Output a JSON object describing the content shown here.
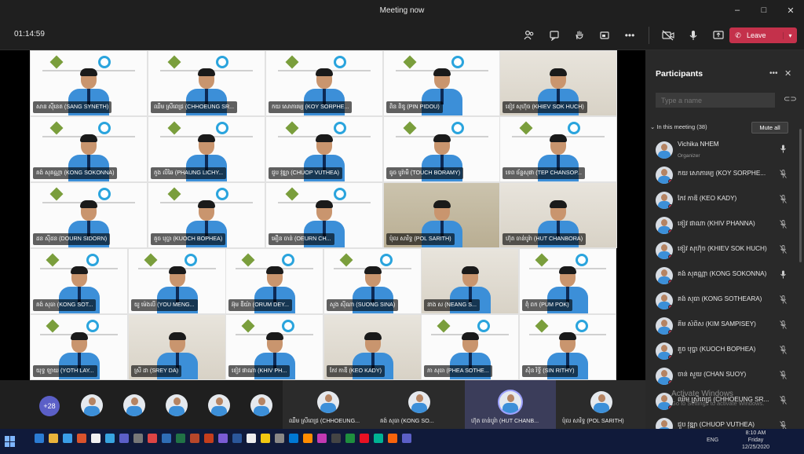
{
  "window": {
    "title": "Meeting now",
    "controls": [
      "–",
      "□",
      "✕"
    ]
  },
  "toolbar": {
    "timer": "01:14:59",
    "icons": [
      "participants-icon",
      "chat-icon",
      "raise-hand-icon",
      "rooms-icon",
      "more-icon",
      "camera-off-icon",
      "mic-icon",
      "share-icon"
    ],
    "leave_label": "Leave"
  },
  "colors": {
    "leave": "#c4314b",
    "panel": "#292929",
    "accent": "#5b5fc7"
  },
  "grid": {
    "tiles": [
      {
        "name": "សាន ស៊ីនេត (SANG SYNETH)"
      },
      {
        "name": "ឈឹម ស្រីពេជ្រ (CHHOEUNG SR..."
      },
      {
        "name": "កយ សោភារម្យ (KOY SORPHE..."
      },
      {
        "name": "ពិន ពិឌូ (PIN PIDOU)"
      },
      {
        "name": "ខៀវ សុហ៊ុច (KHIEV SOK HUCH)"
      },
      {
        "name": "គង់ សុគណ្ណា (KONG SOKONNA)"
      },
      {
        "name": "ភួង លីឆៃ (PHAUNG LICHY..."
      },
      {
        "name": "ជួប វុឌ្ឍា (CHUOP VUTHEA)"
      },
      {
        "name": "ធូច បូរ៉ាមី (TOUCH BORAMY)"
      },
      {
        "name": "ទេព ច័ន្ទសុផា (TEP CHANSOP..."
      },
      {
        "name": "ដន ស៊ីដន (DOURN SIDORN)"
      },
      {
        "name": "គួច បុប្ផា (KUOCH BOPHEA)"
      },
      {
        "name": "អឿន ចាន់ (OEURN CH..."
      },
      {
        "name": "ប៉ុល សារិទ្ធ (POL SARITH)"
      },
      {
        "name": "ហ៊ុត ចាន់បូរ៉ា (HUT CHANBORA)"
      },
      {
        "name": "គង់ សុធា (KONG SOT..."
      },
      {
        "name": "យូ ម៉េងលី (YOU MENG..."
      },
      {
        "name": "អ៊ុម ឌីយ៉ា (ORUM DEY..."
      },
      {
        "name": "សួង ស៊ីណា (SUONG SINA)"
      },
      {
        "name": "នាង ស (NEANG S..."
      },
      {
        "name": "ពុំ ពក (PUM POK)"
      },
      {
        "name": "យុទ្ធ ឡាយ (YOTH LAY..."
      },
      {
        "name": "ស្រី ដា (SREY DA)"
      },
      {
        "name": "ខៀវ ផាណា (KHIV PH..."
      },
      {
        "name": "កែវ កាឌី (KEO KADY)"
      },
      {
        "name": "ភា សុធា (PHEA SOTHE..."
      },
      {
        "name": "ស៊ិន រិទ្ធី (SIN RITHY)"
      }
    ]
  },
  "panel": {
    "title": "Participants",
    "search_placeholder": "Type a name",
    "section": "In this meeting (38)",
    "mute_all": "Mute all",
    "participants": [
      {
        "name": "Vichika NHEM",
        "role": "Organizer",
        "mic": "on"
      },
      {
        "name": "កយ សោភារម្យ (KOY SORPHE...",
        "mic": "off"
      },
      {
        "name": "កែវ កាឌី (KEO KADY)",
        "mic": "off"
      },
      {
        "name": "ខៀវ ផាណា (KHIV PHANNA)",
        "mic": "off"
      },
      {
        "name": "ខៀវ សុហ៊ុច (KHIEV SOK HUCH)",
        "mic": "off"
      },
      {
        "name": "គង់ សុគណ្ណា (KONG SOKONNA)",
        "mic": "on"
      },
      {
        "name": "គង់ សុធា (KONG SOTHEARA)",
        "mic": "off"
      },
      {
        "name": "គីម សំពិស (KIM SAMPISEY)",
        "mic": "off"
      },
      {
        "name": "គួច បុប្ផា (KUOCH BOPHEA)",
        "mic": "off"
      },
      {
        "name": "ចាន់ សួយ (CHAN SUOY)",
        "mic": "off"
      },
      {
        "name": "ឈឹម ស្រីពេជ្រ (CHHOEUNG SR...",
        "mic": "off"
      },
      {
        "name": "ជួប វុឌ្ឍា (CHUOP VUTHEA)",
        "mic": "off"
      }
    ],
    "watermark": "Activate Windows",
    "watermark_sub": "Go to Settings to activate Windows."
  },
  "strip": {
    "overflow": "+28",
    "tiles": [
      {
        "name": "ឈឹម ស្រីពេជ្រ (CHHOEUNG..."
      },
      {
        "name": "គង់ សុធា (KONG SO..."
      },
      {
        "name": "ហ៊ុត ចាន់បូរ៉ា (HUT CHANB..."
      },
      {
        "name": "ប៉ុល សារិទ្ធ (POL SARITH)"
      }
    ]
  },
  "taskbar": {
    "lang": "ENG",
    "time": "8:10 AM",
    "day": "Friday",
    "date": "12/25/2020"
  }
}
